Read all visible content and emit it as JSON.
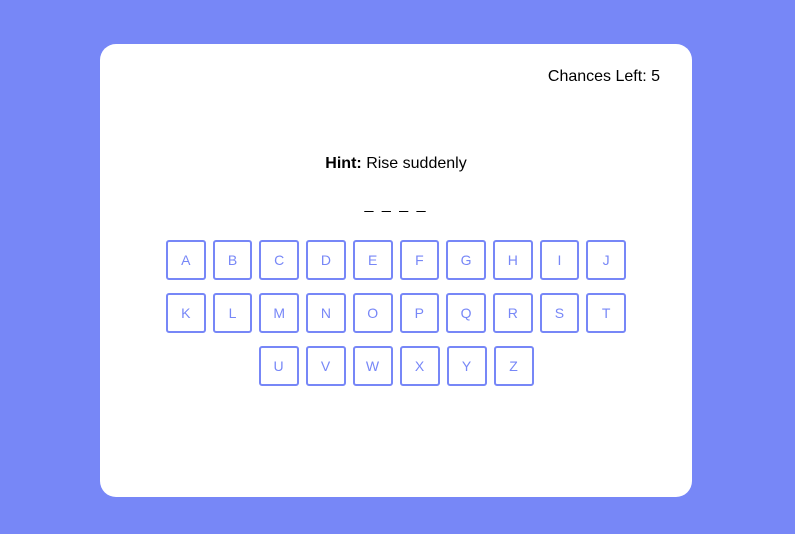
{
  "chances_label": "Chances Left:",
  "chances_value": "5",
  "hint": {
    "label": "Hint:",
    "text": "Rise suddenly"
  },
  "word_display": "_ _ _ _",
  "keyboard": {
    "row1": [
      "A",
      "B",
      "C",
      "D",
      "E",
      "F",
      "G",
      "H",
      "I",
      "J"
    ],
    "row2": [
      "K",
      "L",
      "M",
      "N",
      "O",
      "P",
      "Q",
      "R",
      "S",
      "T"
    ],
    "row3": [
      "U",
      "V",
      "W",
      "X",
      "Y",
      "Z"
    ]
  },
  "colors": {
    "background": "#7787f7",
    "accent": "#7787f7",
    "card": "#ffffff"
  }
}
